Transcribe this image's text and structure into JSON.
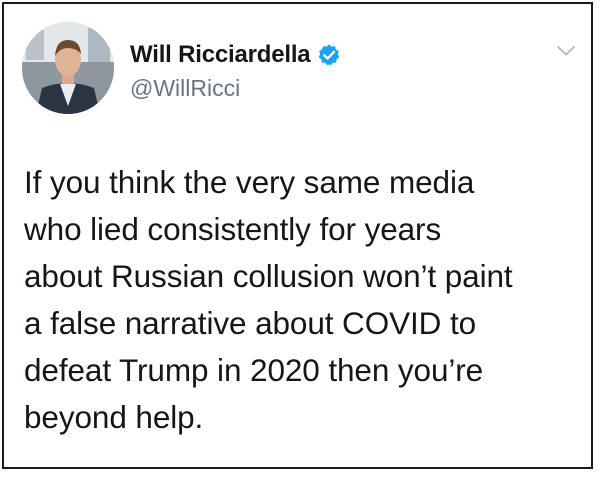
{
  "tweet": {
    "author": {
      "display_name": "Will Ricciardella",
      "handle": "@WillRicci",
      "verified": true,
      "avatar_icon": "profile-photo",
      "verified_icon": "verified-badge-icon"
    },
    "menu_icon": "chevron-down-icon",
    "text": "If you think the very same media\nwho lied consistently for years\nabout Russian collusion won’t paint\na false narrative about COVID to\ndefeat Trump in 2020 then you’re\nbeyond help."
  },
  "colors": {
    "text": "#14171a",
    "secondary_text": "#657786",
    "verified_blue": "#1da1f2",
    "border": "#1a1a1a",
    "background": "#ffffff"
  }
}
